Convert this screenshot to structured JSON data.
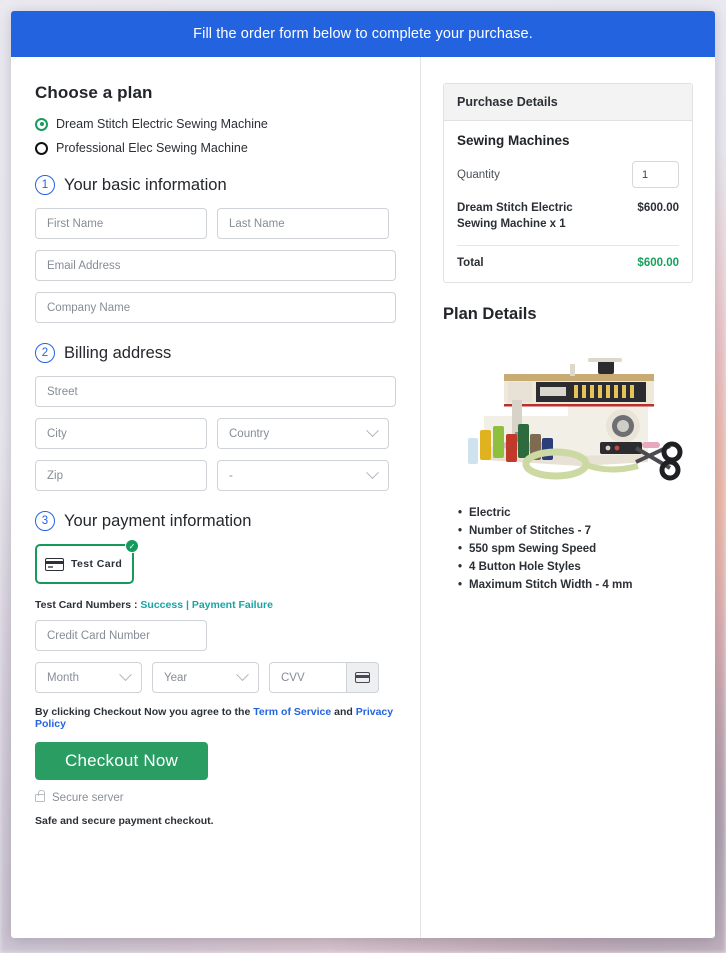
{
  "banner": {
    "text": "Fill the order form below to complete your purchase."
  },
  "plan": {
    "heading": "Choose a plan",
    "options": [
      {
        "label": "Dream Stitch Electric Sewing Machine",
        "selected": true
      },
      {
        "label": "Professional Elec Sewing Machine",
        "selected": false
      }
    ]
  },
  "step1": {
    "num": "1",
    "title": "Your basic information",
    "first_name_placeholder": "First Name",
    "last_name_placeholder": "Last Name",
    "email_placeholder": "Email Address",
    "company_placeholder": "Company Name"
  },
  "step2": {
    "num": "2",
    "title": "Billing address",
    "street_placeholder": "Street",
    "city_placeholder": "City",
    "country_value": "Country",
    "zip_placeholder": "Zip",
    "state_value": "-"
  },
  "step3": {
    "num": "3",
    "title": "Your payment information",
    "method_label": "Test Card",
    "method_selected_icon": "check-badge",
    "test_numbers_prefix": "Test Card Numbers : ",
    "test_success_link": "Success",
    "test_separator": " | ",
    "test_failure_link": "Payment Failure",
    "card_number_placeholder": "Credit Card Number",
    "month_value": "Month",
    "year_value": "Year",
    "cvv_placeholder": "CVV"
  },
  "footer": {
    "terms_prefix": "By clicking Checkout Now you agree to the ",
    "terms_link": "Term of Service",
    "terms_middle": " and ",
    "privacy_link": "Privacy Policy",
    "checkout_label": "Checkout Now",
    "secure_label": "Secure server",
    "safe_note": "Safe and secure payment checkout."
  },
  "purchase": {
    "header": "Purchase Details",
    "product_group": "Sewing Machines",
    "quantity_label": "Quantity",
    "quantity_value": "1",
    "line_item_name": "Dream Stitch Electric Sewing Machine x 1",
    "line_item_price": "$600.00",
    "total_label": "Total",
    "total_value": "$600.00"
  },
  "plan_details": {
    "heading": "Plan Details",
    "image_alt": "sewing-machine-photo",
    "features": [
      "Electric",
      "Number of Stitches - 7",
      "550 spm Sewing Speed",
      "4 Button Hole Styles",
      "Maximum Stitch Width - 4 mm"
    ]
  },
  "colors": {
    "banner_blue": "#2463e0",
    "checkout_green": "#2a9d63",
    "total_green": "#17a05d",
    "link_blue": "#2463e0",
    "link_teal": "#1aa3a3",
    "selected_radio_green": "#1a9a5f"
  }
}
